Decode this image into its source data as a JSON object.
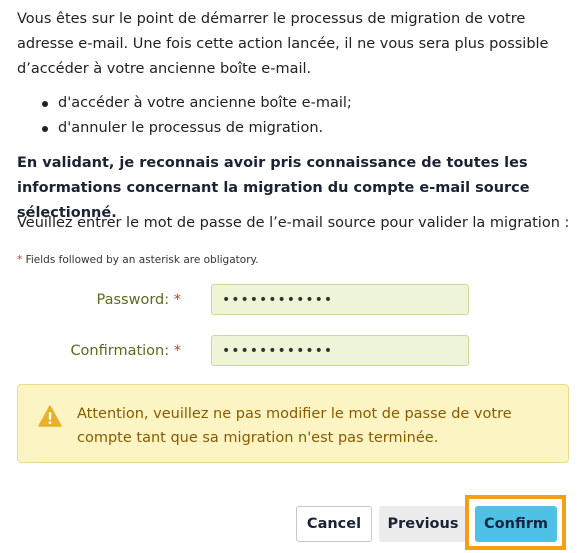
{
  "intro": {
    "line1": "Vous êtes sur le point de démarrer le processus de migration de votre adresse e-mail. Une fois cette action lancée, il ne vous sera plus possible d’accéder à votre ancienne boîte e-mail."
  },
  "bullets": [
    "d'accéder à votre ancienne boîte e-mail;",
    "d'annuler le processus de migration."
  ],
  "acknowledgement": "En validant, je reconnais avoir pris connaissance de toutes les informations concernant la migration du compte e-mail source sélectionné.",
  "prompt": "Veuillez entrer le mot de passe de l’e-mail source pour valider la migration :",
  "required_note": "Fields followed by an asterisk are obligatory.",
  "asterisk": "*",
  "form": {
    "password_label": "Password:",
    "password_value": "••••••••••••",
    "confirmation_label": "Confirmation:",
    "confirmation_value": "••••••••••••"
  },
  "warning": {
    "icon": "warning-triangle-icon",
    "text": "Attention, veuillez ne pas modifier le mot de passe de votre compte tant que sa migration n'est pas terminée."
  },
  "buttons": {
    "cancel": "Cancel",
    "previous": "Previous",
    "confirm": "Confirm"
  },
  "colors": {
    "label_green": "#5a6b1e",
    "input_bg": "#eef5d7",
    "warning_bg": "#fcf4c2",
    "warning_text": "#8a5a00",
    "confirm_bg": "#4fc0e6",
    "highlight": "#f4a014"
  }
}
